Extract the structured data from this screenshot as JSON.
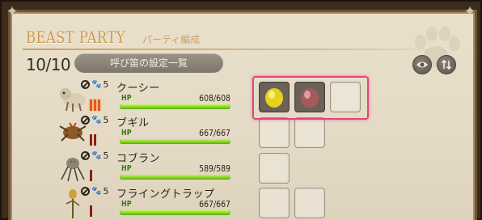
{
  "header": {
    "title_en": "BEAST PARTY",
    "title_jp": "パーティ編成"
  },
  "toolbar": {
    "party_count": "10/10",
    "whistle_settings_label": "呼び笛の設定一覧"
  },
  "members": [
    {
      "name": "クーシー",
      "level": "5",
      "hp": "608/608",
      "hp_fraction": 1.0,
      "rank_bars": 3,
      "rank_active": 3,
      "slots": [
        "lemon-feed",
        "red-feed",
        "empty"
      ]
    },
    {
      "name": "ブギル",
      "level": "5",
      "hp": "667/667",
      "hp_fraction": 1.0,
      "rank_bars": 2,
      "rank_active": 0,
      "slots": [
        "empty",
        "empty"
      ]
    },
    {
      "name": "コブラン",
      "level": "5",
      "hp": "589/589",
      "hp_fraction": 1.0,
      "rank_bars": 1,
      "rank_active": 0,
      "slots": [
        "empty"
      ]
    },
    {
      "name": "フライングトラップ",
      "level": "5",
      "hp": "667/667",
      "hp_fraction": 1.0,
      "rank_bars": 1,
      "rank_active": 0,
      "slots": [
        "empty",
        "empty"
      ]
    }
  ],
  "hp_label": "HP",
  "icons": {
    "view": "eye-icon",
    "sort": "sort-icon"
  },
  "colors": {
    "accent_highlight": "#e0457e",
    "hp_green": "#7ed321",
    "title_gold": "#c99b52"
  }
}
